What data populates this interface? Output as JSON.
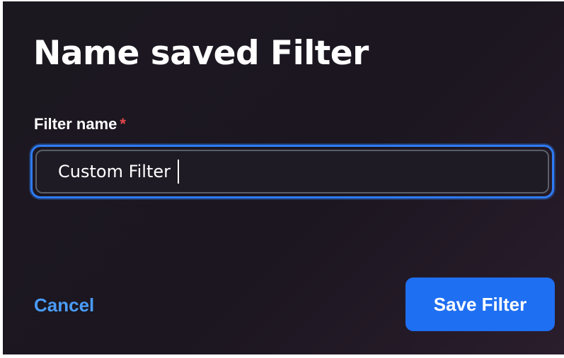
{
  "dialog": {
    "title": "Name saved Filter",
    "field": {
      "label": "Filter name",
      "required_marker": "*",
      "value": "Custom Filter"
    },
    "actions": {
      "cancel_label": "Cancel",
      "save_label": "Save Filter"
    }
  },
  "colors": {
    "background": "#1c1820",
    "accent": "#1e6ff2",
    "link": "#4a9cf7",
    "required": "#e5484d",
    "focus_ring": "#2e7cf6"
  }
}
